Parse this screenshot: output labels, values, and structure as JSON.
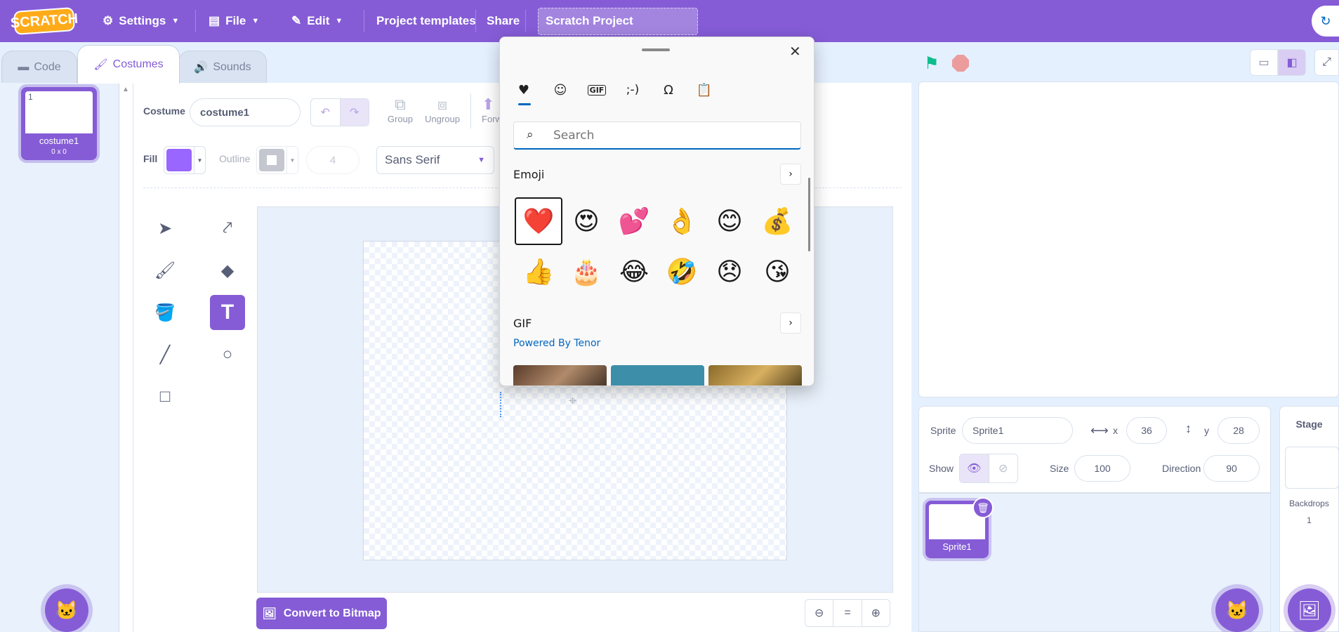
{
  "menubar": {
    "logo": "SCRATCH",
    "settings": "Settings",
    "file": "File",
    "edit": "Edit",
    "templates": "Project templates",
    "share": "Share",
    "project_title": "Scratch Project"
  },
  "tabs": {
    "code": "Code",
    "costumes": "Costumes",
    "sounds": "Sounds"
  },
  "costume_list": [
    {
      "number": "1",
      "name": "costume1",
      "size": "0 x 0"
    }
  ],
  "paint": {
    "costume_label": "Costume",
    "costume_name": "costume1",
    "group": "Group",
    "ungroup": "Ungroup",
    "forward": "Forw",
    "fill_label": "Fill",
    "outline_label": "Outline",
    "outline_width": "4",
    "font": "Sans Serif",
    "convert": "Convert to Bitmap",
    "zoom_reset": "="
  },
  "picker": {
    "search_placeholder": "Search",
    "emoji_heading": "Emoji",
    "gif_heading": "GIF",
    "powered": "Powered By Tenor",
    "kaomoji_tab": ";-)",
    "gif_tab": "GIF",
    "emojis": [
      "❤️",
      "😍",
      "💕",
      "👌",
      "😊",
      "💰",
      "👍",
      "🎂",
      "😂",
      "🤣",
      "😞",
      "😘"
    ]
  },
  "sprite_info": {
    "sprite_label": "Sprite",
    "sprite_name": "Sprite1",
    "x_label": "x",
    "x": "36",
    "y_label": "y",
    "y": "28",
    "show_label": "Show",
    "size_label": "Size",
    "size": "100",
    "direction_label": "Direction",
    "direction": "90"
  },
  "sprites": [
    {
      "name": "Sprite1"
    }
  ],
  "stage_pane": {
    "title": "Stage",
    "backdrops_label": "Backdrops",
    "backdrops_count": "1"
  },
  "colors": {
    "accent": "#855cd6",
    "fill": "#9966ff",
    "picker_accent": "#0067c0"
  }
}
